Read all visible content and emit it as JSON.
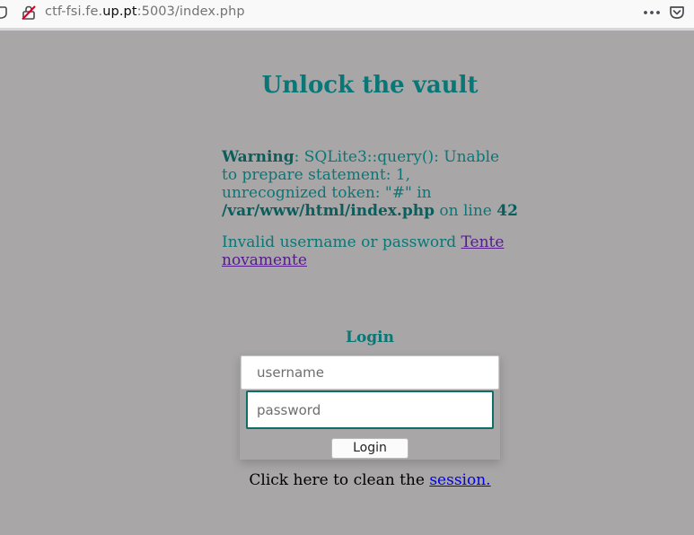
{
  "browser": {
    "url_prefix": "ctf-fsi.fe.",
    "url_domain": "up.pt",
    "url_suffix": ":5003/index.php",
    "icons": {
      "left": "shield-icon",
      "lock": "insecure-lock-icon",
      "menu": "more-actions-icon",
      "pocket": "pocket-icon"
    }
  },
  "page": {
    "title": "Unlock the vault",
    "warning": {
      "label": "Warning",
      "message": ": SQLite3::query(): Unable to prepare statement: 1, unrecognized token: \"#\" in ",
      "path": "/var/www/html/index.php",
      "on_line": " on line ",
      "line_number": "42"
    },
    "error": {
      "message": "Invalid username or password ",
      "retry_link": "Tente novamente"
    },
    "login": {
      "heading": "Login",
      "username_placeholder": "username",
      "password_placeholder": "password",
      "button_label": "Login"
    },
    "session": {
      "text": "Click here to clean the ",
      "link": "session."
    }
  },
  "colors": {
    "background": "#a8a6a7",
    "accent": "#097776",
    "visited_link": "#551a8b",
    "link": "#0000ee"
  }
}
